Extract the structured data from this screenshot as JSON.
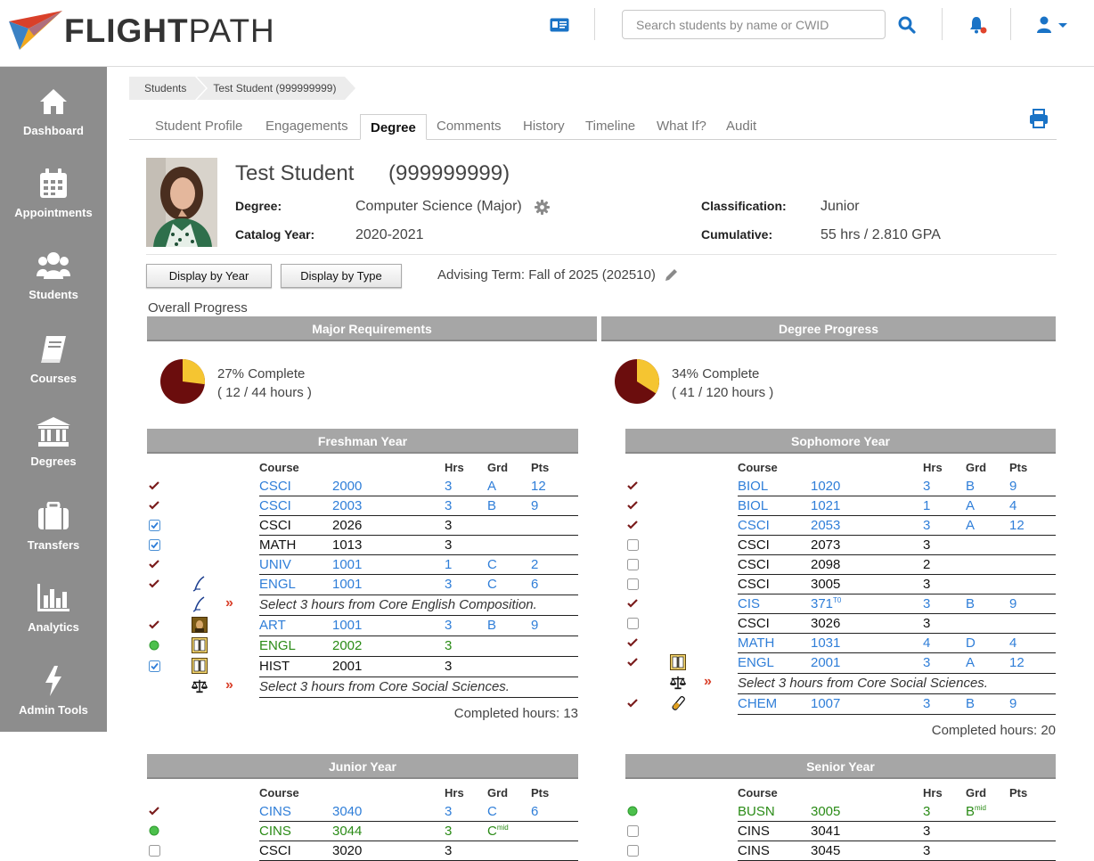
{
  "brand": {
    "name_bold": "FLIGHT",
    "name_light": "PATH"
  },
  "header": {
    "search_placeholder": "Search students by name or CWID"
  },
  "sidebar": {
    "items": [
      {
        "label": "Dashboard",
        "icon": "home-icon"
      },
      {
        "label": "Appointments",
        "icon": "calendar-icon"
      },
      {
        "label": "Students",
        "icon": "users-icon"
      },
      {
        "label": "Courses",
        "icon": "book-icon"
      },
      {
        "label": "Degrees",
        "icon": "university-icon"
      },
      {
        "label": "Transfers",
        "icon": "suitcase-icon"
      },
      {
        "label": "Analytics",
        "icon": "chart-icon"
      },
      {
        "label": "Admin Tools",
        "icon": "bolt-icon"
      }
    ]
  },
  "breadcrumb": [
    "Students",
    "Test Student (999999999)"
  ],
  "tabs": [
    "Student Profile",
    "Engagements",
    "Degree",
    "Comments",
    "History",
    "Timeline",
    "What If?",
    "Audit"
  ],
  "active_tab": "Degree",
  "student": {
    "name": "Test Student",
    "id": "(999999999)",
    "degree_label": "Degree:",
    "degree": "Computer Science (Major)",
    "catalog_label": "Catalog Year:",
    "catalog": "2020-2021",
    "class_label": "Classification:",
    "classification": "Junior",
    "cum_label": "Cumulative:",
    "cumulative": "55 hrs / 2.810 GPA"
  },
  "buttons": {
    "by_year": "Display by Year",
    "by_type": "Display by Type"
  },
  "advising_term": "Advising Term: Fall of 2025 (202510)",
  "progress": {
    "title": "Overall Progress",
    "major": {
      "header": "Major Requirements",
      "pct_text": "27% Complete",
      "hours_text": "( 12 / 44 hours )",
      "fraction": 0.27
    },
    "degree": {
      "header": "Degree Progress",
      "pct_text": "34% Complete",
      "hours_text": "( 41 / 120 hours )",
      "fraction": 0.34
    },
    "colors": {
      "done": "#6b0d0d",
      "remaining": "#f5c531"
    }
  },
  "col_headers": {
    "course": "Course",
    "hrs": "Hrs",
    "grd": "Grd",
    "pts": "Pts"
  },
  "years": {
    "freshman": {
      "title": "Freshman Year",
      "completed": "Completed hours: 13",
      "rows": [
        {
          "status": "check",
          "icon": "",
          "subj": "CSCI",
          "num": "2000",
          "hrs": "3",
          "grd": "A",
          "pts": "12",
          "color": "blue"
        },
        {
          "status": "check",
          "icon": "",
          "subj": "CSCI",
          "num": "2003",
          "hrs": "3",
          "grd": "B",
          "pts": "9",
          "color": "blue"
        },
        {
          "status": "checkbox-checked",
          "icon": "",
          "subj": "CSCI",
          "num": "2026",
          "hrs": "3",
          "grd": "",
          "pts": "",
          "color": "black"
        },
        {
          "status": "checkbox-checked",
          "icon": "",
          "subj": "MATH",
          "num": "1013",
          "hrs": "3",
          "grd": "",
          "pts": "",
          "color": "black"
        },
        {
          "status": "check",
          "icon": "",
          "subj": "UNIV",
          "num": "1001",
          "hrs": "1",
          "grd": "C",
          "pts": "2",
          "color": "blue"
        },
        {
          "status": "check",
          "icon": "pen",
          "subj": "ENGL",
          "num": "1001",
          "hrs": "3",
          "grd": "C",
          "pts": "6",
          "color": "blue"
        },
        {
          "status": "",
          "icon": "pen",
          "arrow": true,
          "select": "Select 3 hours from Core English Composition."
        },
        {
          "status": "check",
          "icon": "art",
          "subj": "ART",
          "num": "1001",
          "hrs": "3",
          "grd": "B",
          "pts": "9",
          "color": "blue"
        },
        {
          "status": "dot",
          "icon": "book",
          "subj": "ENGL",
          "num": "2002",
          "hrs": "3",
          "grd": "",
          "pts": "",
          "color": "green"
        },
        {
          "status": "checkbox-checked",
          "icon": "book",
          "subj": "HIST",
          "num": "2001",
          "hrs": "3",
          "grd": "",
          "pts": "",
          "color": "black"
        },
        {
          "status": "",
          "icon": "scale",
          "arrow": true,
          "select": "Select 3 hours from Core Social Sciences."
        }
      ]
    },
    "sophomore": {
      "title": "Sophomore Year",
      "completed": "Completed hours: 20",
      "rows": [
        {
          "status": "check",
          "icon": "",
          "subj": "BIOL",
          "num": "1020",
          "hrs": "3",
          "grd": "B",
          "pts": "9",
          "color": "blue"
        },
        {
          "status": "check",
          "icon": "",
          "subj": "BIOL",
          "num": "1021",
          "hrs": "1",
          "grd": "A",
          "pts": "4",
          "color": "blue"
        },
        {
          "status": "check",
          "icon": "",
          "subj": "CSCI",
          "num": "2053",
          "hrs": "3",
          "grd": "A",
          "pts": "12",
          "color": "blue"
        },
        {
          "status": "checkbox",
          "icon": "",
          "subj": "CSCI",
          "num": "2073",
          "hrs": "3",
          "grd": "",
          "pts": "",
          "color": "black"
        },
        {
          "status": "checkbox",
          "icon": "",
          "subj": "CSCI",
          "num": "2098",
          "hrs": "2",
          "grd": "",
          "pts": "",
          "color": "black"
        },
        {
          "status": "checkbox",
          "icon": "",
          "subj": "CSCI",
          "num": "3005",
          "hrs": "3",
          "grd": "",
          "pts": "",
          "color": "black"
        },
        {
          "status": "check",
          "icon": "",
          "subj": "CIS",
          "num": "371",
          "num_sup": "T0",
          "hrs": "3",
          "grd": "B",
          "pts": "9",
          "color": "blue"
        },
        {
          "status": "checkbox",
          "icon": "",
          "subj": "CSCI",
          "num": "3026",
          "hrs": "3",
          "grd": "",
          "pts": "",
          "color": "black"
        },
        {
          "status": "check",
          "icon": "",
          "subj": "MATH",
          "num": "1031",
          "hrs": "4",
          "grd": "D",
          "pts": "4",
          "color": "blue"
        },
        {
          "status": "check",
          "icon": "book",
          "subj": "ENGL",
          "num": "2001",
          "hrs": "3",
          "grd": "A",
          "pts": "12",
          "color": "blue"
        },
        {
          "status": "",
          "icon": "scale",
          "arrow": true,
          "select": "Select 3 hours from Core Social Sciences."
        },
        {
          "status": "check",
          "icon": "flask",
          "subj": "CHEM",
          "num": "1007",
          "hrs": "3",
          "grd": "B",
          "pts": "9",
          "color": "blue"
        }
      ]
    },
    "junior": {
      "title": "Junior Year",
      "rows": [
        {
          "status": "check",
          "icon": "",
          "subj": "CINS",
          "num": "3040",
          "hrs": "3",
          "grd": "C",
          "pts": "6",
          "color": "blue"
        },
        {
          "status": "dot",
          "icon": "",
          "subj": "CINS",
          "num": "3044",
          "hrs": "3",
          "grd": "C",
          "grd_sup": "mid",
          "pts": "",
          "color": "green"
        },
        {
          "status": "checkbox",
          "icon": "",
          "subj": "CSCI",
          "num": "3020",
          "hrs": "3",
          "grd": "",
          "pts": "",
          "color": "black"
        }
      ]
    },
    "senior": {
      "title": "Senior Year",
      "rows": [
        {
          "status": "dot",
          "icon": "",
          "subj": "BUSN",
          "num": "3005",
          "hrs": "3",
          "grd": "B",
          "grd_sup": "mid",
          "pts": "",
          "color": "green"
        },
        {
          "status": "checkbox",
          "icon": "",
          "subj": "CINS",
          "num": "3041",
          "hrs": "3",
          "grd": "",
          "pts": "",
          "color": "black"
        },
        {
          "status": "checkbox",
          "icon": "",
          "subj": "CINS",
          "num": "3045",
          "hrs": "3",
          "grd": "",
          "pts": "",
          "color": "black"
        }
      ]
    }
  }
}
